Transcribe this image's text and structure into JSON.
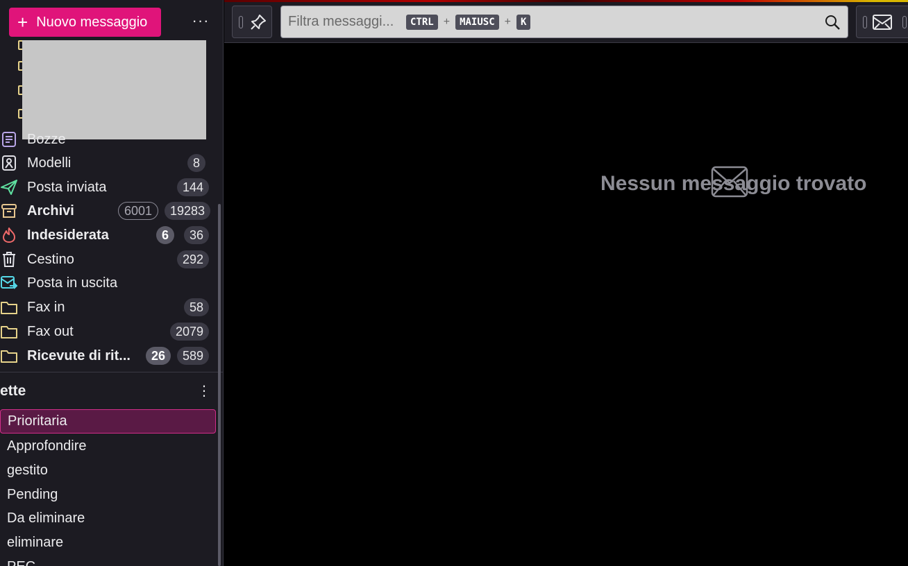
{
  "sidebar": {
    "new_message_label": "Nuovo messaggio",
    "folders": [
      {
        "label": "Bozze",
        "bold": false,
        "icon": "drafts-icon",
        "count": ""
      },
      {
        "label": "Modelli",
        "bold": false,
        "icon": "templates-icon",
        "count": "8"
      },
      {
        "label": "Posta inviata",
        "bold": false,
        "icon": "sent-icon",
        "count": "144"
      },
      {
        "label": "Archivi",
        "bold": true,
        "icon": "archive-icon",
        "unread": "6001",
        "count": "19283"
      },
      {
        "label": "Indesiderata",
        "bold": true,
        "icon": "junk-icon",
        "unread": "6",
        "count": "36"
      },
      {
        "label": "Cestino",
        "bold": false,
        "icon": "trash-icon",
        "count": "292"
      },
      {
        "label": "Posta in uscita",
        "bold": false,
        "icon": "outbox-icon",
        "count": ""
      },
      {
        "label": "Fax in",
        "bold": false,
        "icon": "folder-icon",
        "count": "58"
      },
      {
        "label": "Fax out",
        "bold": false,
        "icon": "folder-icon",
        "count": "2079"
      },
      {
        "label": "Ricevute di rit...",
        "bold": true,
        "icon": "folder-icon",
        "unread": "26",
        "count": "589"
      }
    ],
    "tags_header": "ette",
    "tags": [
      "Prioritaria",
      "Approfondire",
      "gestito",
      "Pending",
      "Da eliminare",
      "eliminare",
      "PEC"
    ]
  },
  "search": {
    "placeholder": "Filtra messaggi...",
    "shortcut_keys": [
      "CTRL",
      "MAIUSC",
      "K"
    ],
    "plus": "+"
  },
  "main": {
    "empty_message": "Nessun messaggio trovato"
  },
  "colors": {
    "accent": "#e0147a",
    "sidebar_bg": "#1c1b22",
    "selected_tag_bg": "#5a1a45",
    "folder_yellow": "#e6d28a"
  }
}
